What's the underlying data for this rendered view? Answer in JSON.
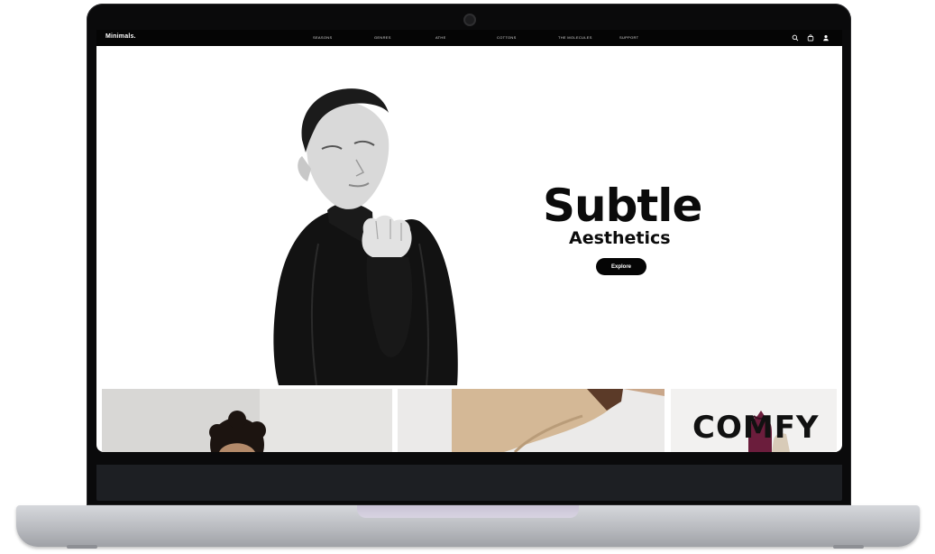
{
  "site": {
    "brand": "Minimals."
  },
  "nav": {
    "items": [
      "SEASONS",
      "GENRES",
      "ATHE",
      "COTTONS",
      "THE MOLECULES",
      "SUPPORT"
    ]
  },
  "header_icons": [
    "search-icon",
    "bag-icon",
    "user-icon"
  ],
  "hero": {
    "headline": "Subtle",
    "subline": "Aesthetics",
    "cta_label": "Explore"
  },
  "tiles": {
    "comfy_word": "COMFY"
  },
  "colors": {
    "nav_bg": "#050505",
    "button_bg": "#050505",
    "text": "#0b0b0b",
    "laptop_bezel": "#0a0a0b",
    "laptop_base": "#b6b8bd"
  }
}
